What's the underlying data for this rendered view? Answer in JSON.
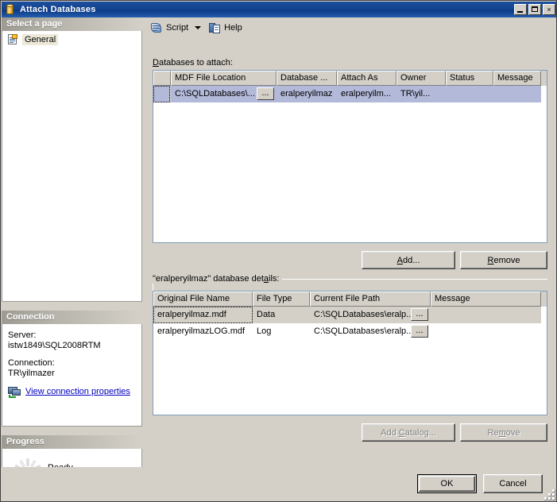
{
  "window": {
    "title": "Attach Databases",
    "icon": "database-cylinder-icon",
    "minimize_label": "Minimize",
    "maximize_label": "Maximize",
    "close_label": "×"
  },
  "sidebar": {
    "select_page_header": "Select a page",
    "pages": [
      {
        "label": "General",
        "icon": "page-general-icon",
        "selected": true
      }
    ],
    "connection": {
      "header": "Connection",
      "server_label": "Server:",
      "server_value": "istw1849\\SQL2008RTM",
      "connection_label": "Connection:",
      "connection_value": "TR\\yilmazer",
      "link_text": "View connection properties",
      "link_icon": "server-connection-icon"
    },
    "progress": {
      "header": "Progress",
      "status": "Ready",
      "spinner_icon": "progress-spinner-icon"
    }
  },
  "toolbar": {
    "script_label": "Script",
    "script_icon": "script-icon",
    "script_caret_icon": "chevron-down-icon",
    "help_label": "Help",
    "help_icon": "help-icon"
  },
  "attach_grid": {
    "label": "Databases to attach:",
    "label_accel": "D",
    "columns": [
      {
        "key": "rowhead",
        "header": "",
        "width": 22
      },
      {
        "key": "mdf",
        "header": "MDF File Location",
        "width": 133
      },
      {
        "key": "dbname",
        "header": "Database ...",
        "width": 76
      },
      {
        "key": "attachas",
        "header": "Attach As",
        "width": 75
      },
      {
        "key": "owner",
        "header": "Owner",
        "width": 62
      },
      {
        "key": "status",
        "header": "Status",
        "width": 60
      },
      {
        "key": "message",
        "header": "Message",
        "width": 60
      }
    ],
    "rows": [
      {
        "selected": true,
        "focused": true,
        "mdf": "C:\\SQLDatabases\\...",
        "mdf_browse_label": "...",
        "dbname": "eralperyilmaz",
        "attachas": "eralperyilm...",
        "owner": "TR\\yil...",
        "status": "",
        "message": ""
      }
    ]
  },
  "buttons": {
    "add": {
      "label": "Add...",
      "accel": "A",
      "enabled": true
    },
    "remove_top": {
      "label": "Remove",
      "accel": "R",
      "enabled": true
    },
    "add_catalog": {
      "label": "Add Catalog...",
      "accel": "C",
      "enabled": false
    },
    "remove_bottom": {
      "label": "Remove",
      "accel": "m",
      "enabled": false
    },
    "ok": {
      "label": "OK",
      "default": true
    },
    "cancel": {
      "label": "Cancel"
    }
  },
  "details_grid": {
    "label": "\"eralperyilmaz\" database details:",
    "label_accel": "a",
    "columns": [
      {
        "key": "original",
        "header": "Original File Name",
        "width": 125
      },
      {
        "key": "filetype",
        "header": "File Type",
        "width": 72
      },
      {
        "key": "currentpath",
        "header": "Current File Path",
        "width": 152
      },
      {
        "key": "message",
        "header": "Message",
        "width": 139
      }
    ],
    "rows": [
      {
        "selected": true,
        "focused": true,
        "original": "eralperyilmaz.mdf",
        "filetype": "Data",
        "currentpath": "C:\\SQLDatabases\\eralp...",
        "browse_label": "...",
        "message": ""
      },
      {
        "selected": false,
        "focused": false,
        "original": "eralperyilmazLOG.mdf",
        "filetype": "Log",
        "currentpath": "C:\\SQLDatabases\\eralp...",
        "browse_label": "...",
        "message": ""
      }
    ]
  },
  "colors": {
    "dialog_face": "#d4d0c8",
    "title_blue": "#14438e",
    "selection_blue": "#b3b9d9",
    "selection_gray": "#d4d0c8",
    "link_blue": "#0000c0",
    "grid_border": "#7f9db9"
  },
  "resize_grip_icon": "resize-grip-icon"
}
